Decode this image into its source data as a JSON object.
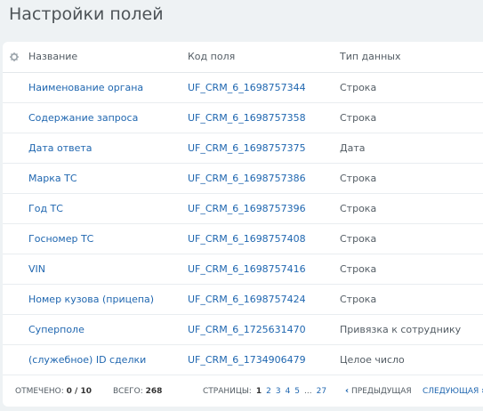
{
  "page": {
    "title": "Настройки полей"
  },
  "table": {
    "columns": [
      "Название",
      "Код поля",
      "Тип данных"
    ],
    "rows": [
      {
        "name": "Наименование органа",
        "code": "UF_CRM_6_1698757344",
        "type": "Строка"
      },
      {
        "name": "Содержание запроса",
        "code": "UF_CRM_6_1698757358",
        "type": "Строка"
      },
      {
        "name": "Дата ответа",
        "code": "UF_CRM_6_1698757375",
        "type": "Дата"
      },
      {
        "name": "Марка ТС",
        "code": "UF_CRM_6_1698757386",
        "type": "Строка"
      },
      {
        "name": "Год ТС",
        "code": "UF_CRM_6_1698757396",
        "type": "Строка"
      },
      {
        "name": "Госномер ТС",
        "code": "UF_CRM_6_1698757408",
        "type": "Строка"
      },
      {
        "name": "VIN",
        "code": "UF_CRM_6_1698757416",
        "type": "Строка"
      },
      {
        "name": "Номер кузова (прицепа)",
        "code": "UF_CRM_6_1698757424",
        "type": "Строка"
      },
      {
        "name": "Суперполе",
        "code": "UF_CRM_6_1725631470",
        "type": "Привязка к сотруднику"
      },
      {
        "name": "(служебное) ID сделки",
        "code": "UF_CRM_6_1734906479",
        "type": "Целое число"
      }
    ]
  },
  "footer": {
    "selected_label": "ОТМЕЧЕНО:",
    "selected_value": "0 / 10",
    "total_label": "ВСЕГО:",
    "total_value": "268",
    "pages_label": "СТРАНИЦЫ:",
    "pages": [
      "1",
      "2",
      "3",
      "4",
      "5",
      "...",
      "27"
    ],
    "current_page": "1",
    "prev_label": "ПРЕДЫДУЩАЯ",
    "next_label": "СЛЕДУЮЩАЯ"
  },
  "colors": {
    "link": "#2067b0",
    "background": "#eef2f4",
    "text": "#535c64"
  },
  "icons": {
    "settings": "gear-icon",
    "prev": "chevron-left-icon",
    "next": "chevron-right-icon"
  }
}
